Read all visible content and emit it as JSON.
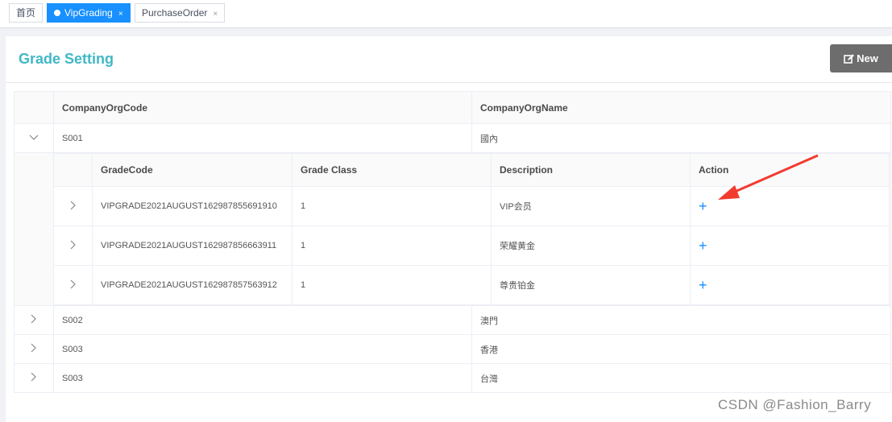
{
  "tabs": [
    {
      "label": "首页",
      "active": false,
      "closable": false
    },
    {
      "label": "VipGrading",
      "active": true,
      "closable": true
    },
    {
      "label": "PurchaseOrder",
      "active": false,
      "closable": true
    }
  ],
  "tab_close_glyph": "×",
  "card": {
    "title": "Grade Setting",
    "new_button_label": "New",
    "new_button_icon": "edit-icon"
  },
  "outer_table": {
    "headers": [
      "CompanyOrgCode",
      "CompanyOrgName"
    ],
    "rows": [
      {
        "code": "S001",
        "name": "國內",
        "expanded": true
      },
      {
        "code": "S002",
        "name": "澳門",
        "expanded": false
      },
      {
        "code": "S003",
        "name": "香港",
        "expanded": false
      },
      {
        "code": "S003",
        "name": "台灣",
        "expanded": false
      }
    ]
  },
  "inner_table": {
    "headers": [
      "GradeCode",
      "Grade Class",
      "Description",
      "Action"
    ],
    "rows": [
      {
        "code": "VIPGRADE2021AUGUST162987855691910",
        "grade_class": "1",
        "description": "VIP会员",
        "action": "+"
      },
      {
        "code": "VIPGRADE2021AUGUST162987856663911",
        "grade_class": "1",
        "description": "荣耀黄金",
        "action": "+"
      },
      {
        "code": "VIPGRADE2021AUGUST162987857563912",
        "grade_class": "1",
        "description": "尊贵铂金",
        "action": "+"
      }
    ]
  },
  "annotation": {
    "arrow_color": "#f23b2f"
  },
  "watermark": "CSDN @Fashion_Barry",
  "colors": {
    "accent": "#1890ff",
    "title": "#3fb8c5",
    "button": "#6d6d6d"
  }
}
